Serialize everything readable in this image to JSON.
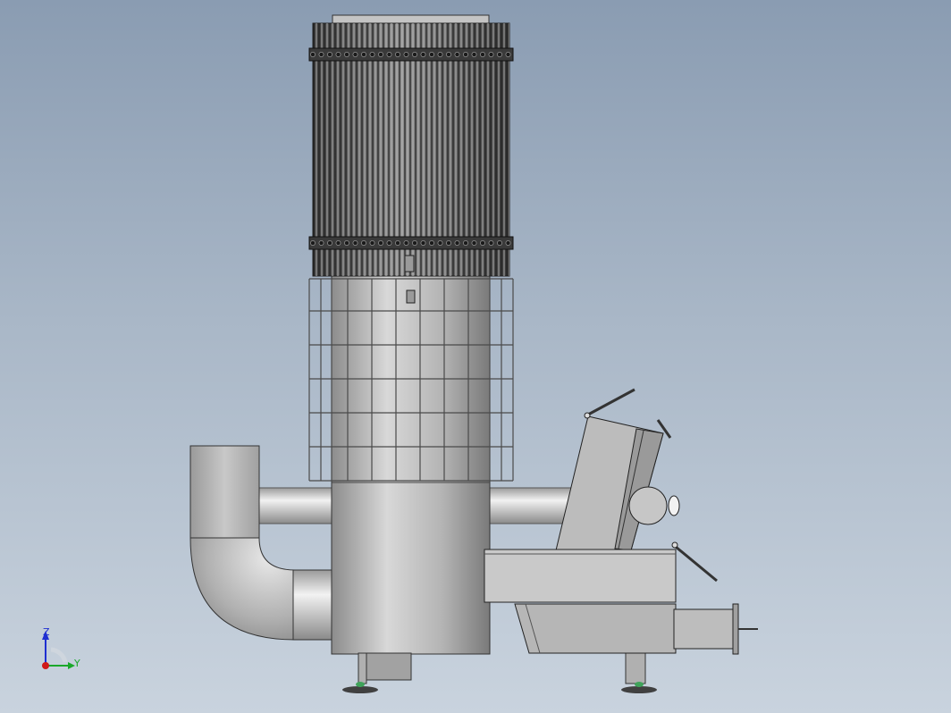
{
  "viewport": {
    "background_top": "#8a9cb2",
    "background_bottom": "#c9d3de"
  },
  "model": {
    "description_icon": "cad-assembly-side-view",
    "colors": {
      "metal_light": "#d4d4d4",
      "metal_mid": "#a8a8a8",
      "metal_dark": "#6e6e6e",
      "edge": "#2e2e2e",
      "green_foot": "#3fa35a"
    }
  },
  "triad": {
    "z_label": "Z",
    "y_label": "Y",
    "z_color": "#1f2fd1",
    "y_color": "#1aa82a",
    "origin_color": "#d01818"
  }
}
